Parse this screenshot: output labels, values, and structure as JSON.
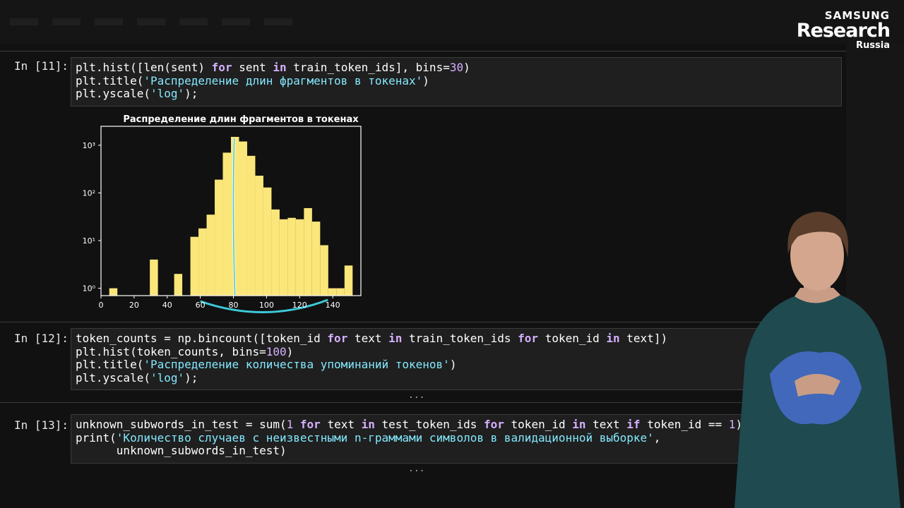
{
  "brand": {
    "line1": "SAMSUNG",
    "line2": "Research",
    "line3": "Russia"
  },
  "cells": [
    {
      "prompt": "In [11]:",
      "code": [
        [
          [
            "plt.hist([",
            "t"
          ],
          [
            "len",
            "t"
          ],
          [
            "(sent) ",
            "t"
          ],
          [
            "for",
            "kw"
          ],
          [
            " sent ",
            "t"
          ],
          [
            "in",
            "kw"
          ],
          [
            " train_token_ids], bins=",
            "t"
          ],
          [
            "30",
            "num"
          ],
          [
            ")",
            "t"
          ]
        ],
        [
          [
            "plt.title(",
            "t"
          ],
          [
            "'Распределение длин фрагментов в токенах'",
            "str"
          ],
          [
            ")",
            "t"
          ]
        ],
        [
          [
            "plt.yscale(",
            "t"
          ],
          [
            "'log'",
            "str"
          ],
          [
            ");",
            "t"
          ]
        ]
      ]
    },
    {
      "prompt": "In [12]:",
      "code": [
        [
          [
            "token_counts = np.bincount([token_id ",
            "t"
          ],
          [
            "for",
            "kw"
          ],
          [
            " text ",
            "t"
          ],
          [
            "in",
            "kw"
          ],
          [
            " train_token_ids ",
            "t"
          ],
          [
            "for",
            "kw"
          ],
          [
            " token_id ",
            "t"
          ],
          [
            "in",
            "kw"
          ],
          [
            " text])",
            "t"
          ]
        ],
        [
          [
            "plt.hist(token_counts, bins=",
            "t"
          ],
          [
            "100",
            "num"
          ],
          [
            ")",
            "t"
          ]
        ],
        [
          [
            "plt.title(",
            "t"
          ],
          [
            "'Распределение количества упоминаний токенов'",
            "str"
          ],
          [
            ")",
            "t"
          ]
        ],
        [
          [
            "plt.yscale(",
            "t"
          ],
          [
            "'log'",
            "str"
          ],
          [
            ");",
            "t"
          ]
        ]
      ],
      "ellipsis": "..."
    },
    {
      "prompt": "In [13]:",
      "code": [
        [
          [
            "unknown_subwords_in_test = sum(",
            "t"
          ],
          [
            "1",
            "num"
          ],
          [
            " ",
            "t"
          ],
          [
            "for",
            "kw"
          ],
          [
            " text ",
            "t"
          ],
          [
            "in",
            "kw"
          ],
          [
            " test_token_ids ",
            "t"
          ],
          [
            "for",
            "kw"
          ],
          [
            " token_id ",
            "t"
          ],
          [
            "in",
            "kw"
          ],
          [
            " text ",
            "t"
          ],
          [
            "if",
            "kw"
          ],
          [
            " token_id == ",
            "t"
          ],
          [
            "1",
            "num"
          ],
          [
            ")",
            "t"
          ]
        ],
        [
          [
            "print(",
            "t"
          ],
          [
            "'Количество случаев с неизвестными n-граммами символов в валидационной выборке'",
            "str"
          ],
          [
            ",",
            "t"
          ]
        ],
        [
          [
            "      unknown_subwords_in_test)",
            "t"
          ]
        ]
      ],
      "ellipsis": "..."
    }
  ],
  "chart_data": {
    "type": "bar",
    "title": "Распределение длин фрагментов в токенах",
    "yscale": "log",
    "xlim": [
      0,
      157
    ],
    "ylim": [
      0.7,
      2500
    ],
    "xticks": [
      0,
      20,
      40,
      60,
      80,
      100,
      120,
      140
    ],
    "yticks": [
      {
        "value": 1,
        "label": "10⁰"
      },
      {
        "value": 10,
        "label": "10¹"
      },
      {
        "value": 100,
        "label": "10²"
      },
      {
        "value": 1000,
        "label": "10³"
      }
    ],
    "bin_width": 4.9,
    "bins": [
      {
        "x": 5.0,
        "count": 1
      },
      {
        "x": 29.5,
        "count": 4
      },
      {
        "x": 44.2,
        "count": 2
      },
      {
        "x": 54.0,
        "count": 12
      },
      {
        "x": 58.9,
        "count": 18
      },
      {
        "x": 63.8,
        "count": 35
      },
      {
        "x": 68.7,
        "count": 190
      },
      {
        "x": 73.6,
        "count": 700
      },
      {
        "x": 78.5,
        "count": 1500
      },
      {
        "x": 83.4,
        "count": 1200
      },
      {
        "x": 88.3,
        "count": 600
      },
      {
        "x": 93.2,
        "count": 230
      },
      {
        "x": 98.1,
        "count": 130
      },
      {
        "x": 103.0,
        "count": 45
      },
      {
        "x": 107.9,
        "count": 28
      },
      {
        "x": 112.8,
        "count": 30
      },
      {
        "x": 117.7,
        "count": 28
      },
      {
        "x": 122.6,
        "count": 48
      },
      {
        "x": 127.5,
        "count": 25
      },
      {
        "x": 132.4,
        "count": 8
      },
      {
        "x": 137.3,
        "count": 1
      },
      {
        "x": 142.2,
        "count": 1
      },
      {
        "x": 147.1,
        "count": 3
      }
    ],
    "bar_color": "#fbe67a",
    "annotation_color": "#3dc9d8"
  }
}
